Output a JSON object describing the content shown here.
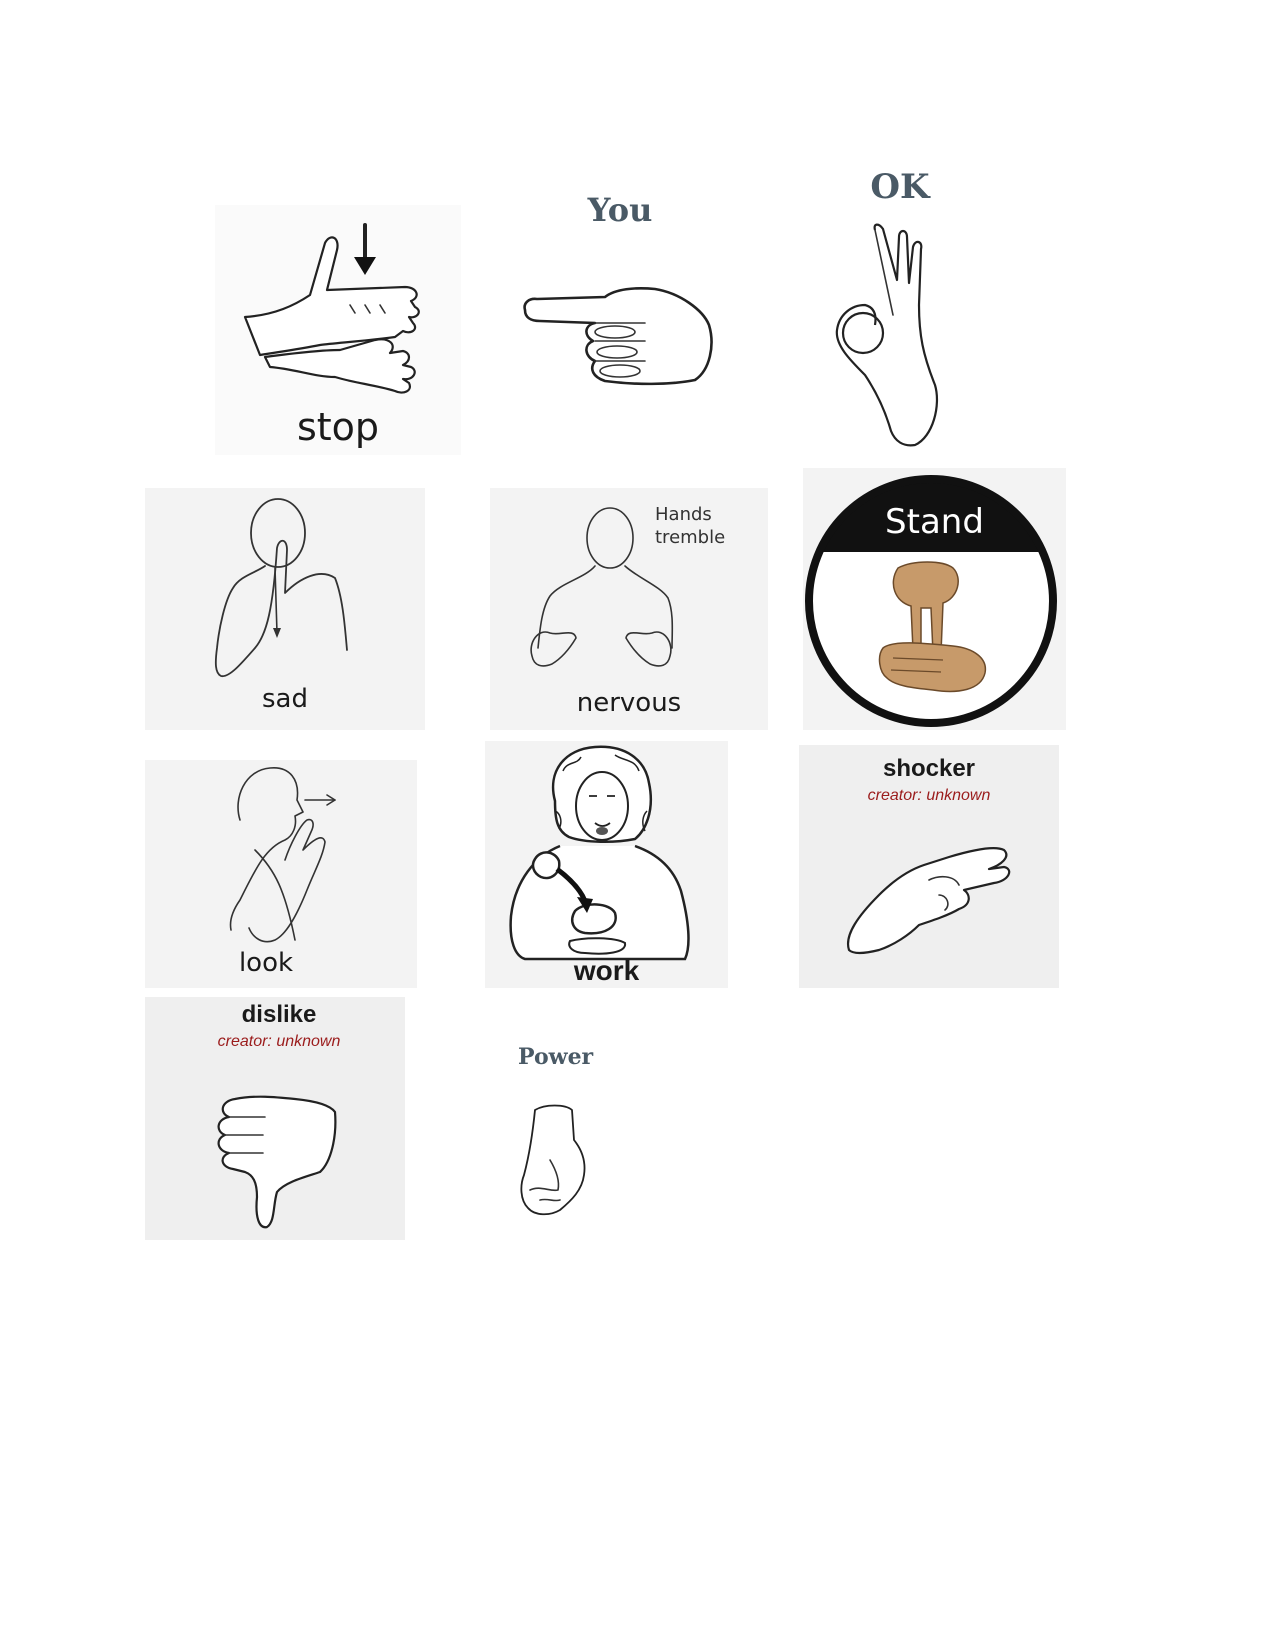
{
  "signs": {
    "stop": {
      "label": "stop"
    },
    "you": {
      "label": "You"
    },
    "ok": {
      "label": "OK"
    },
    "sad": {
      "label": "sad"
    },
    "nervous": {
      "label": "nervous",
      "note_line1": "Hands",
      "note_line2": "tremble"
    },
    "stand": {
      "label": "Stand"
    },
    "look": {
      "label": "look"
    },
    "work": {
      "label": "work"
    },
    "shocker": {
      "label": "shocker",
      "creator": "creator: unknown"
    },
    "dislike": {
      "label": "dislike",
      "creator": "creator: unknown"
    },
    "power": {
      "label": "Power"
    }
  },
  "colors": {
    "card_bg": "#f3f3f3",
    "title_serif": "#4a5a66",
    "creator_red": "#9b1c1c",
    "skin": "#c79a6a"
  }
}
